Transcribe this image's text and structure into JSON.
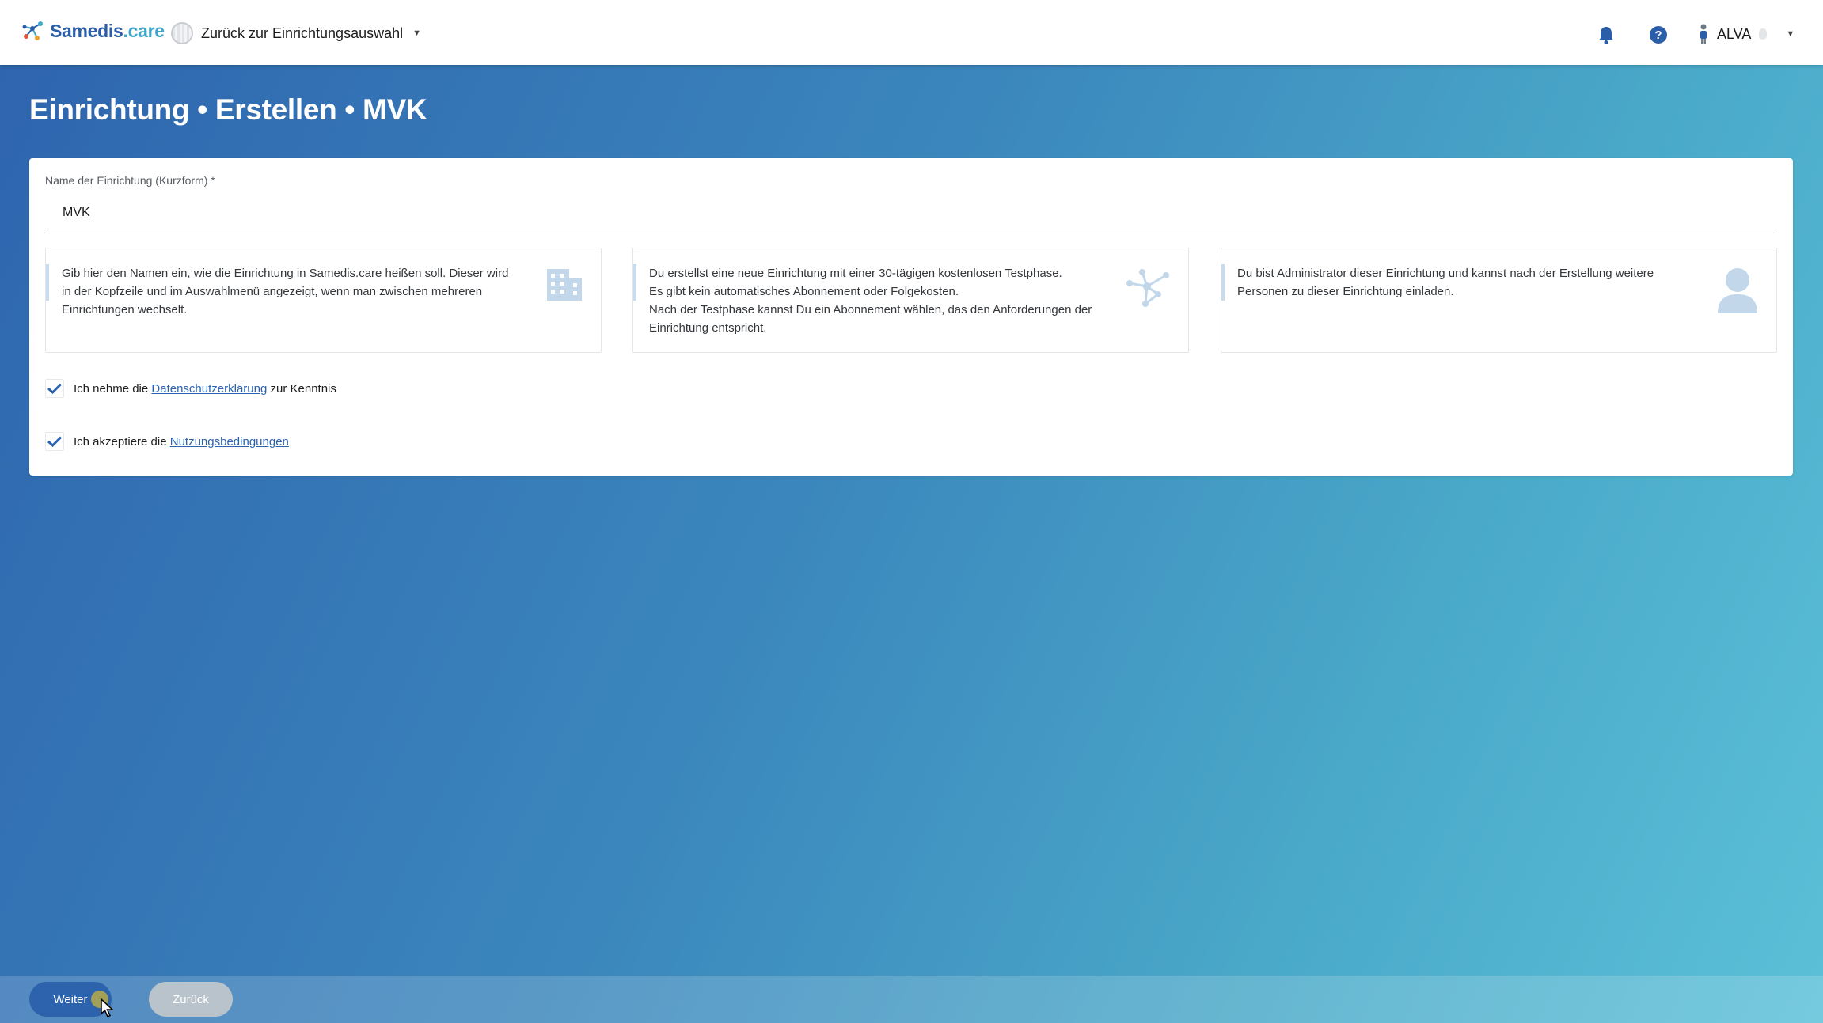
{
  "header": {
    "logo": {
      "main": "Samedis",
      "tld": ".care"
    },
    "tenant_switch_label": "Zurück zur Einrichtungsauswahl",
    "notifications_icon": "bell-icon",
    "help_icon": "help-circle-icon",
    "user": {
      "name": "ALVA",
      "avatar_icon": "user-figure-icon"
    }
  },
  "page": {
    "title": "Einrichtung • Erstellen • MVK"
  },
  "form": {
    "name_field": {
      "label": "Name der Einrichtung (Kurzform) *",
      "value": "MVK"
    },
    "info_boxes": [
      {
        "text": "Gib hier den Namen ein, wie die Einrichtung in Samedis.care heißen soll. Dieser wird in der Kopfzeile und im Auswahlmenü angezeigt, wenn man zwischen mehreren Einrichtungen wechselt.",
        "icon": "building-icon"
      },
      {
        "text_line1": "Du erstellst eine neue Einrichtung mit einer 30-tägigen kostenlosen Testphase.",
        "text_line2": "Es gibt kein automatisches Abonnement oder Folgekosten.",
        "text_line3": "Nach der Testphase kannst Du ein Abonnement wählen, das den Anforderungen der Einrichtung entspricht.",
        "icon": "network-icon"
      },
      {
        "text": "Du bist Administrator dieser Einrichtung und kannst nach der Erstellung weitere Personen zu dieser Einrichtung einladen.",
        "icon": "person-icon"
      }
    ],
    "privacy": {
      "checked": true,
      "before": "Ich nehme die",
      "link": "Datenschutzerklärung",
      "after": "zur Kenntnis"
    },
    "terms": {
      "checked": true,
      "before": "Ich akzeptiere die",
      "link": "Nutzungsbedingungen"
    }
  },
  "footer": {
    "next_label": "Weiter",
    "back_label": "Zurück"
  },
  "colors": {
    "brand_blue": "#2a5ea8",
    "brand_teal": "#3fa7c9",
    "link": "#2a64b0",
    "check": "#2a64b0"
  }
}
